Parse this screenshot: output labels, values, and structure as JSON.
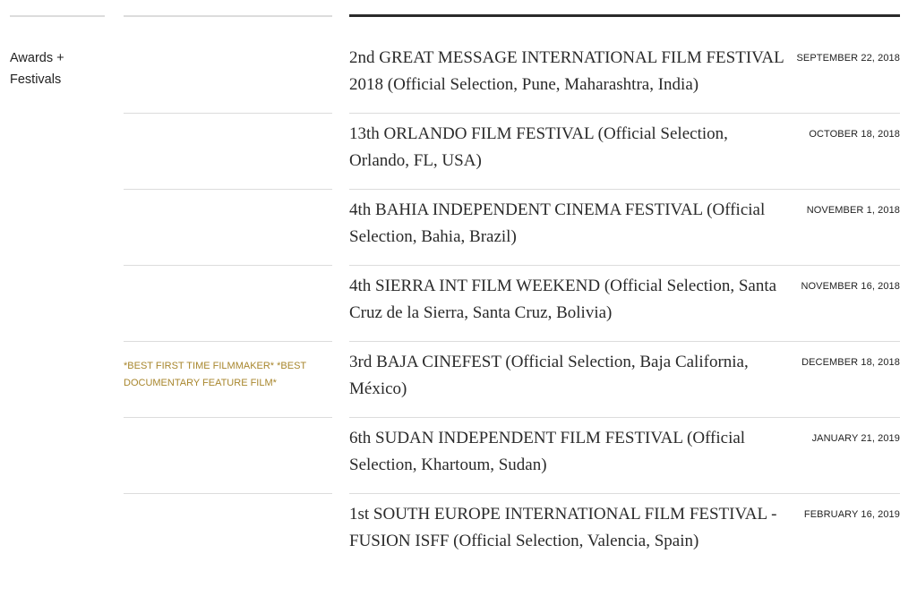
{
  "section": {
    "label": "Awards + Festivals"
  },
  "festivals": [
    {
      "title": "2nd GREAT MESSAGE INTERNATIONAL FILM FESTIVAL 2018 (Official Selection, Pune, Maharashtra, India)",
      "date": "SEPTEMBER 22, 2018",
      "award": ""
    },
    {
      "title": "13th ORLANDO FILM FESTIVAL (Official Selection, Orlando, FL, USA)",
      "date": "OCTOBER 18, 2018",
      "award": ""
    },
    {
      "title": "4th BAHIA INDEPENDENT CINEMA FESTIVAL (Official Selection, Bahia, Brazil)",
      "date": "NOVEMBER 1, 2018",
      "award": ""
    },
    {
      "title": "4th SIERRA INT FILM WEEKEND (Official Selection, Santa Cruz de la Sierra, Santa Cruz, Bolivia)",
      "date": "NOVEMBER 16, 2018",
      "award": ""
    },
    {
      "title": "3rd BAJA CINEFEST (Official Selection, Baja California, México)",
      "date": "DECEMBER 18, 2018",
      "award": "*BEST FIRST TIME FILMMAKER* *BEST DOCUMENTARY FEATURE FILM*"
    },
    {
      "title": "6th SUDAN INDEPENDENT FILM FESTIVAL (Official Selection, Khartoum, Sudan)",
      "date": "JANUARY 21, 2019",
      "award": ""
    },
    {
      "title": "1st SOUTH EUROPE INTERNATIONAL FILM FESTIVAL - FUSION ISFF (Official Selection, Valencia, Spain)",
      "date": "FEBRUARY 16, 2019",
      "award": ""
    }
  ]
}
